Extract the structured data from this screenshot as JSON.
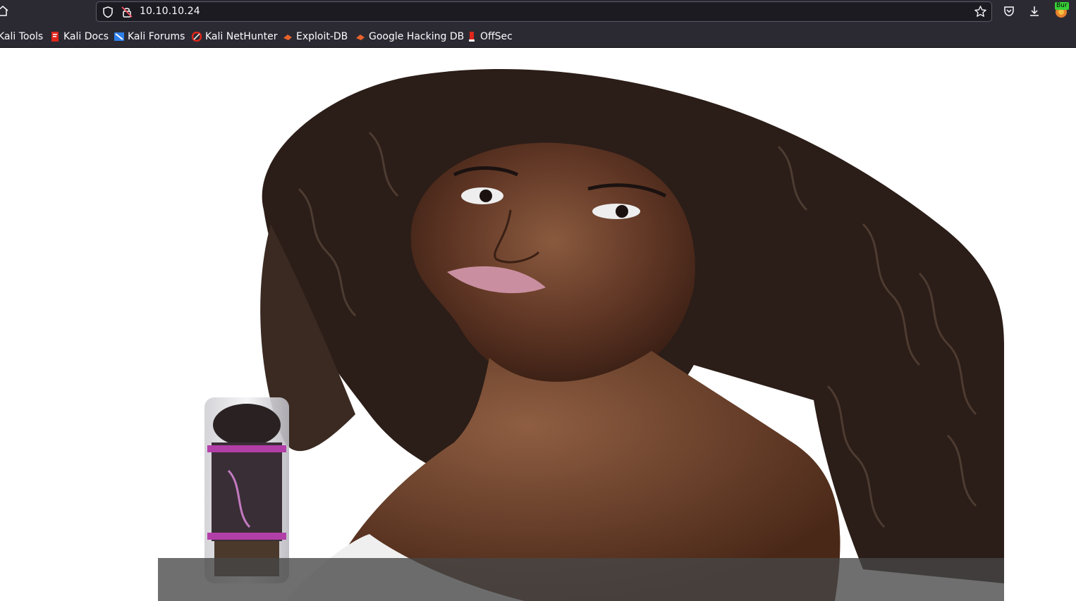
{
  "browser": {
    "url": "10.10.10.24",
    "extension_badge": "Bur"
  },
  "bookmarks": [
    {
      "label": "Kali Tools",
      "icon": "kali-tools-icon"
    },
    {
      "label": "Kali Docs",
      "icon": "kali-docs-icon"
    },
    {
      "label": "Kali Forums",
      "icon": "kali-forums-icon"
    },
    {
      "label": "Kali NetHunter",
      "icon": "kali-nethunter-icon"
    },
    {
      "label": "Exploit-DB",
      "icon": "exploit-db-icon"
    },
    {
      "label": "Google Hacking DB",
      "icon": "google-hacking-db-icon"
    },
    {
      "label": "OffSec",
      "icon": "offsec-icon"
    }
  ],
  "page": {
    "hero_image": "woman-with-curly-hair-and-hair-product-tube",
    "colors": {
      "chrome_bg": "#2b2a33",
      "urlbar_bg": "#1c1b22",
      "page_bg": "#ffffff",
      "overlay": "#464646"
    }
  }
}
